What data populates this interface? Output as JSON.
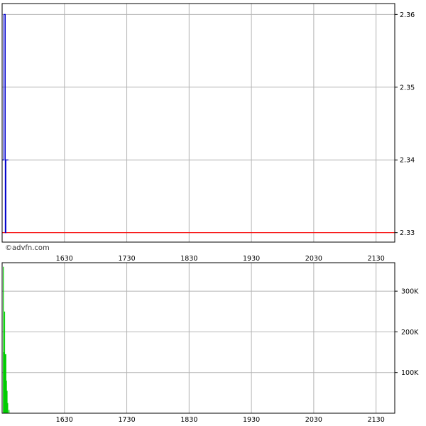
{
  "watermark": "©advfn.com",
  "colors": {
    "background": "#ffffff",
    "grid": "#b4b4b4",
    "frame": "#000000",
    "price_line": "#0000cc",
    "reference_line": "#ff0000",
    "volume_bars": "#00cc00"
  },
  "chart_data": [
    {
      "type": "line",
      "title": "",
      "x_ticks": [
        "1630",
        "1730",
        "1830",
        "1930",
        "2030",
        "2130"
      ],
      "x_tick_values": [
        1630,
        1730,
        1830,
        1930,
        2030,
        2130
      ],
      "xlim": [
        1530,
        2160
      ],
      "y_ticks": [
        "2.36",
        "2.35",
        "2.34",
        "2.33"
      ],
      "y_tick_values": [
        2.36,
        2.35,
        2.34,
        2.33
      ],
      "ylim": [
        2.3287,
        2.3615
      ],
      "y_axis_side": "right",
      "grid": true,
      "series": [
        {
          "x": [
            1530,
            1533,
            1533,
            1534,
            1534,
            1535,
            1535,
            1536,
            1536,
            1537,
            1537,
            1540
          ],
          "y": [
            2.34,
            2.34,
            2.36,
            2.36,
            2.36,
            2.36,
            2.33,
            2.33,
            2.34,
            2.34,
            2.34,
            2.34
          ]
        }
      ],
      "reference_line": {
        "y": 2.33
      }
    },
    {
      "type": "bar",
      "title": "",
      "x_ticks": [
        "1630",
        "1730",
        "1830",
        "1930",
        "2030",
        "2130"
      ],
      "x_tick_values": [
        1630,
        1730,
        1830,
        1930,
        2030,
        2130
      ],
      "xlim": [
        1530,
        2160
      ],
      "y_ticks": [
        "300K",
        "200K",
        "100K"
      ],
      "y_tick_values": [
        300000,
        200000,
        100000
      ],
      "ylim": [
        0,
        370000
      ],
      "y_axis_side": "right",
      "grid": true,
      "x": [
        1532,
        1533,
        1534,
        1535,
        1536,
        1537,
        1538,
        1539,
        1541
      ],
      "values": [
        360000,
        150000,
        250000,
        145000,
        145000,
        80000,
        55000,
        25000,
        8000
      ]
    }
  ]
}
